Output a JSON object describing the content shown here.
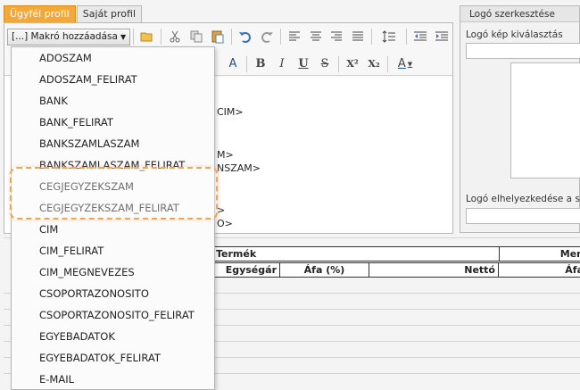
{
  "tabs": [
    {
      "label": "Ügyfél profil",
      "active": true
    },
    {
      "label": "Saját profil",
      "active": false
    }
  ],
  "toolbar": {
    "macro_dropdown_label": "[...] Makró hozzáadása"
  },
  "editor": {
    "lines": [
      "CIM>",
      "M>",
      "NSZAM>",
      ">",
      "O>"
    ]
  },
  "menu": {
    "items": [
      "ADOSZAM",
      "ADOSZAM_FELIRAT",
      "BANK",
      "BANK_FELIRAT",
      "BANKSZAMLASZAM",
      "BANKSZAMLASZAM_FELIRAT",
      "CEGJEGYZEKSZAM",
      "CEGJEGYZEKSZAM_FELIRAT",
      "CIM",
      "CIM_FELIRAT",
      "CIM_MEGNEVEZES",
      "CSOPORTAZONOSITO",
      "CSOPORTAZONOSITO_FELIRAT",
      "EGYEBADATOK",
      "EGYEBADATOK_FELIRAT",
      "E-MAIL"
    ],
    "highlighted": [
      "CEGJEGYZEKSZAM",
      "CEGJEGYZEKSZAM_FELIRAT"
    ]
  },
  "logo_panel": {
    "title": "Logó szerkesztése",
    "image_select_label": "Logó kép kiválasztás",
    "position_label": "Logó elhelyezkedése a szál"
  },
  "table": {
    "group_header": "Termék",
    "group_header_right": "Men",
    "columns": [
      "Egységár",
      "Áfa (%)",
      "Nettó",
      "Áfa"
    ]
  },
  "colors": {
    "active_tab": "#f5a83a",
    "highlight_ring": "#f0a35a"
  }
}
